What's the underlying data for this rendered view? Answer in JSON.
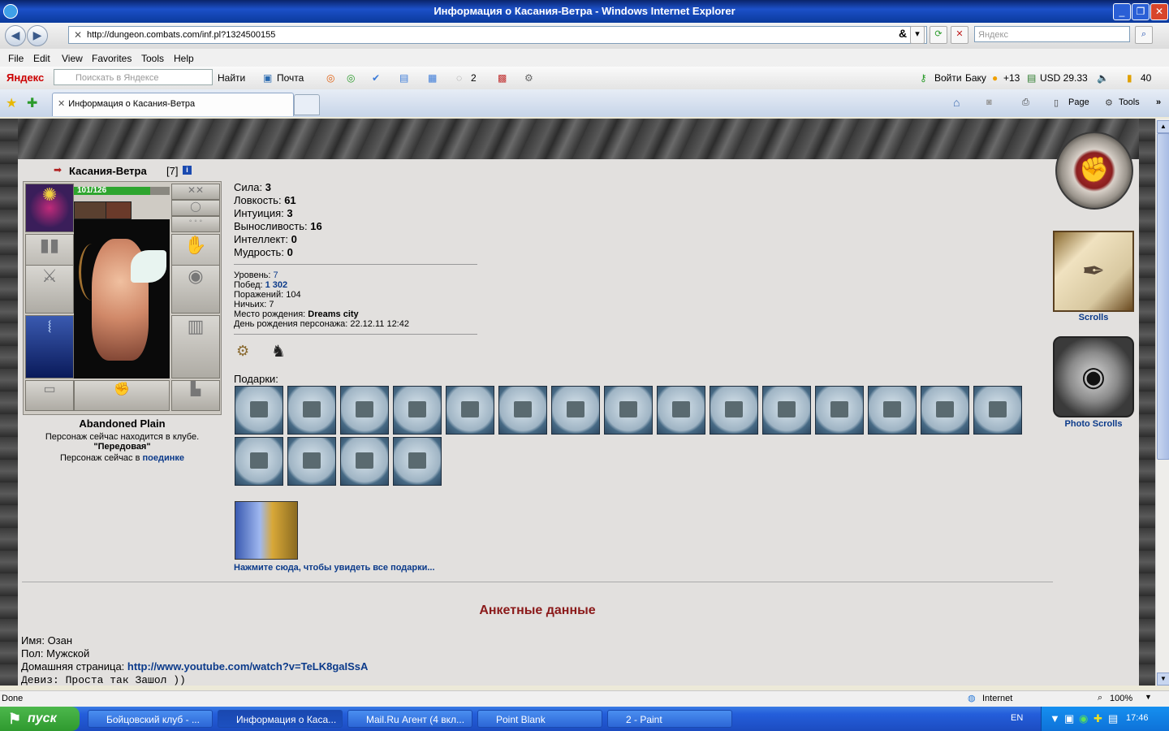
{
  "window": {
    "title": "Информация о Касания-Ветра - Windows Internet Explorer"
  },
  "address_bar": {
    "url": "http://dungeon.combats.com/inf.pl?1324500155",
    "search_placeholder": "Яндекс"
  },
  "menu": [
    "File",
    "Edit",
    "View",
    "Favorites",
    "Tools",
    "Help"
  ],
  "yandex_bar": {
    "logo": "Яндекс",
    "search_placeholder": "Поискать в Яндексе",
    "find_label": "Найти",
    "mail_label": "Почта",
    "comments_count": "2",
    "login_label": "Войти",
    "city": "Баку",
    "weather": "+13",
    "currency": "USD 29.33",
    "signal": "40"
  },
  "tabs": {
    "active_label": "Информация о Касания-Ветра",
    "right_tools": [
      "Page",
      "Tools"
    ]
  },
  "character": {
    "name": "Касания-Ветра",
    "level_tag": "[7]",
    "hp": "101/126",
    "hp_fraction": 0.8,
    "location": "Abandoned Plain",
    "status_line1": "Персонаж сейчас находится в клубе.",
    "club_name": "\"Передовая\"",
    "status_line2_prefix": "Персонаж сейчас в",
    "status_line2_link": "поединке"
  },
  "stats": [
    {
      "label": "Сила:",
      "value": "3"
    },
    {
      "label": "Ловкость:",
      "value": "61"
    },
    {
      "label": "Интуиция:",
      "value": "3"
    },
    {
      "label": "Выносливость:",
      "value": "16"
    },
    {
      "label": "Интеллект:",
      "value": "0"
    },
    {
      "label": "Мудрость:",
      "value": "0"
    }
  ],
  "info": {
    "level_label": "Уровень:",
    "level_value": "7",
    "wins_label": "Побед:",
    "wins_value": "1 302",
    "losses_label": "Поражений:",
    "losses_value": "104",
    "draws_label": "Ничьих:",
    "draws_value": "7",
    "birthplace_label": "Место рождения:",
    "birthplace_value": "Dreams city",
    "birthday_label": "День рождения персонажа:",
    "birthday_value": "22.12.11 12:42"
  },
  "gifts": {
    "label": "Подарки:",
    "count": 19,
    "see_all_link": "Нажмите сюда, чтобы увидеть все подарки..."
  },
  "sidebar": {
    "scrolls_label": "Scrolls",
    "photo_scrolls_label": "Photo Scrolls"
  },
  "profile": {
    "heading": "Анкетные данные",
    "name_label": "Имя:",
    "name_value": "Озан",
    "gender_label": "Пол:",
    "gender_value": "Мужской",
    "homepage_label": "Домашняя страница:",
    "homepage_value": "http://www.youtube.com/watch?v=TeLK8gaISsA",
    "motto_label": "Девиз:",
    "motto_value": "Проста так Зашол ))"
  },
  "status_bar": {
    "left": "Done",
    "zone": "Internet",
    "zoom": "100%"
  },
  "taskbar": {
    "start_label": "пуск",
    "tasks": [
      "Бойцовский клуб - ...",
      "Информация о Каса...",
      "Mail.Ru Агент (4 вкл...",
      "Point Blank",
      "2 - Paint"
    ],
    "lang": "EN",
    "clock": "17:46"
  },
  "colors": {
    "heading_red": "#8b1a1a",
    "link_blue": "#0b3a8a",
    "hp_green": "#2ea52e"
  }
}
